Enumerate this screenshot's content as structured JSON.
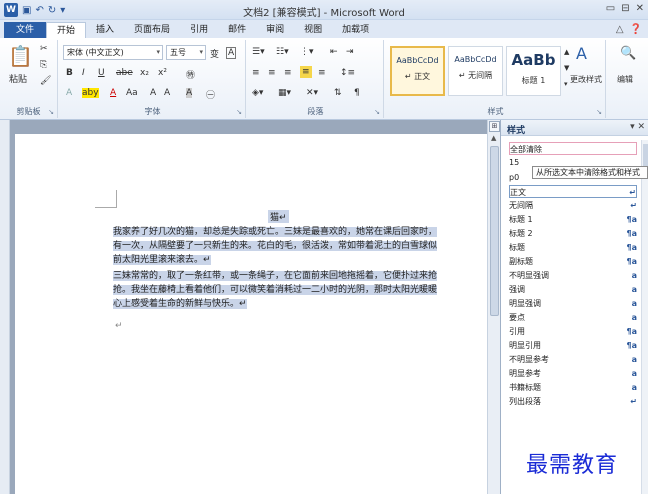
{
  "window": {
    "title": "文档2 [兼容模式] - Microsoft Word",
    "app_icon": "W",
    "qat": [
      "save-icon",
      "undo-icon",
      "redo-icon"
    ],
    "controls": [
      "▭",
      "⊟",
      "✕"
    ]
  },
  "tabs": {
    "file": "文件",
    "items": [
      "开始",
      "插入",
      "页面布局",
      "引用",
      "邮件",
      "审阅",
      "视图",
      "加载项"
    ],
    "active_index": 0,
    "right_icons": [
      "△",
      "❓"
    ]
  },
  "ribbon": {
    "clipboard": {
      "paste": "粘贴",
      "label": "剪贴板"
    },
    "font": {
      "name": "宋体 (中文正文)",
      "size": "五号",
      "label": "字体",
      "buttons_row1": [
        "A",
        "A",
        "Aa",
        "变",
        "A"
      ],
      "buttons_row2": [
        "B",
        "I",
        "U",
        "abe",
        "x₂",
        "x²",
        "㊕"
      ],
      "buttons_row3": [
        "A",
        "aby",
        "A",
        "Aa",
        "A",
        "A",
        "A",
        "㊀"
      ]
    },
    "paragraph": {
      "label": "段落"
    },
    "styles": {
      "label": "样式",
      "items": [
        {
          "sample": "AaBbCcDd",
          "name": "↵ 正文"
        },
        {
          "sample": "AaBbCcDd",
          "name": "↵ 无间隔"
        },
        {
          "sample": "AaBb",
          "name": "标题 1"
        }
      ],
      "change_styles": "更改样式",
      "editing": "编辑"
    }
  },
  "document": {
    "title": "猫↵",
    "lines": [
      "我家养了好几次的猫，却总是失踪或死亡。三妹是最喜欢的，她常在课后回家时，",
      "有一次，从隔壁要了一只新生的来。花白的毛，很活泼，常如带着泥土的白雪球似",
      "前太阳光里滚来滚去。↵",
      "三妹常常的，取了一条红带，或一条绳子，在它面前来回地拖摇着，它便扑过来抢",
      "抢。我坐在藤椅上看着他们，可以微笑着消耗过一二小时的光阴，那时太阳光暖暖",
      "心上感受着生命的新鲜与快乐。↵"
    ],
    "empty_para": "↵"
  },
  "styles_pane": {
    "title": "样式",
    "controls": "▾ ✕",
    "clear_all": "全部清除",
    "tooltip": "从所选文本中清除格式和样式",
    "extra_rows": [
      "15",
      "p0"
    ],
    "items": [
      {
        "name": "正文",
        "mark": "↵"
      },
      {
        "name": "无间隔",
        "mark": "↵"
      },
      {
        "name": "标题 1",
        "mark": "¶a"
      },
      {
        "name": "标题 2",
        "mark": "¶a"
      },
      {
        "name": "标题",
        "mark": "¶a"
      },
      {
        "name": "副标题",
        "mark": "¶a"
      },
      {
        "name": "不明显强调",
        "mark": "a"
      },
      {
        "name": "强调",
        "mark": "a"
      },
      {
        "name": "明显强调",
        "mark": "a"
      },
      {
        "name": "要点",
        "mark": "a"
      },
      {
        "name": "引用",
        "mark": "¶a"
      },
      {
        "name": "明显引用",
        "mark": "¶a"
      },
      {
        "name": "不明显参考",
        "mark": "a"
      },
      {
        "name": "明显参考",
        "mark": "a"
      },
      {
        "name": "书籍标题",
        "mark": "a"
      },
      {
        "name": "列出段落",
        "mark": "↵"
      }
    ]
  },
  "watermark": "最需教育"
}
